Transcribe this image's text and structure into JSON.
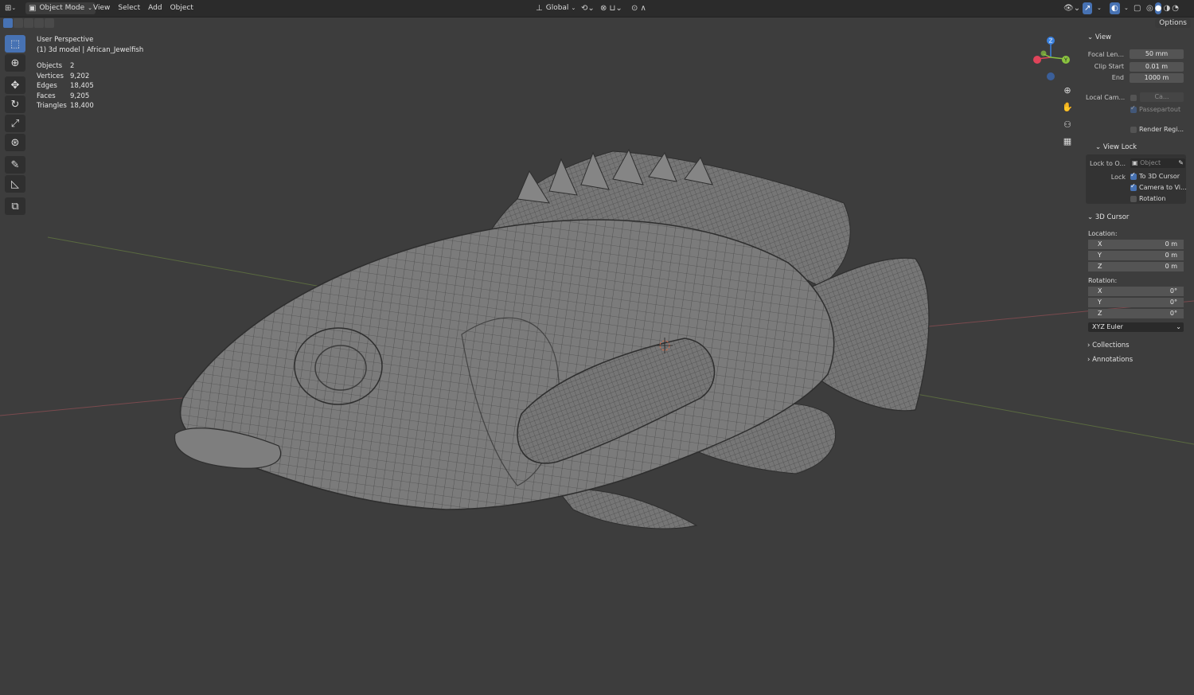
{
  "header": {
    "mode_label": "Object Mode",
    "menus": [
      "View",
      "Select",
      "Add",
      "Object"
    ],
    "transform_orientation": "Global"
  },
  "options_label": "Options",
  "overlay": {
    "view_name": "User Perspective",
    "object_info": "(1) 3d model | African_Jewelfish",
    "stats": [
      {
        "label": "Objects",
        "value": "2"
      },
      {
        "label": "Vertices",
        "value": "9,202"
      },
      {
        "label": "Edges",
        "value": "18,405"
      },
      {
        "label": "Faces",
        "value": "9,205"
      },
      {
        "label": "Triangles",
        "value": "18,400"
      }
    ]
  },
  "gizmo": {
    "x": "",
    "y": "Y",
    "z": "Z"
  },
  "npanel": {
    "view": {
      "title": "View",
      "focal_label": "Focal Len...",
      "focal_value": "50 mm",
      "clip_start_label": "Clip Start",
      "clip_start_value": "0.01 m",
      "end_label": "End",
      "end_value": "1000 m",
      "local_cam_label": "Local Cam...",
      "local_cam_value": "Ca...",
      "passepartout_label": "Passepartout",
      "render_region_label": "Render Regi..."
    },
    "view_lock": {
      "title": "View Lock",
      "lock_to_label": "Lock to O...",
      "lock_to_value": "Object",
      "lock_label": "Lock",
      "to_cursor_label": "To 3D Cursor",
      "camera_label": "Camera to Vi...",
      "rotation_label": "Rotation"
    },
    "cursor": {
      "title": "3D Cursor",
      "location_label": "Location:",
      "location": [
        {
          "axis": "X",
          "value": "0 m"
        },
        {
          "axis": "Y",
          "value": "0 m"
        },
        {
          "axis": "Z",
          "value": "0 m"
        }
      ],
      "rotation_label": "Rotation:",
      "rotation": [
        {
          "axis": "X",
          "value": "0°"
        },
        {
          "axis": "Y",
          "value": "0°"
        },
        {
          "axis": "Z",
          "value": "0°"
        }
      ],
      "rotation_mode": "XYZ Euler"
    },
    "collections_label": "Collections",
    "annotations_label": "Annotations"
  },
  "colors": {
    "accent": "#4772b3",
    "bg": "#3d3d3d",
    "axis_x": "#e0445a",
    "axis_y": "#8bc43f",
    "axis_z": "#3b82e0"
  }
}
